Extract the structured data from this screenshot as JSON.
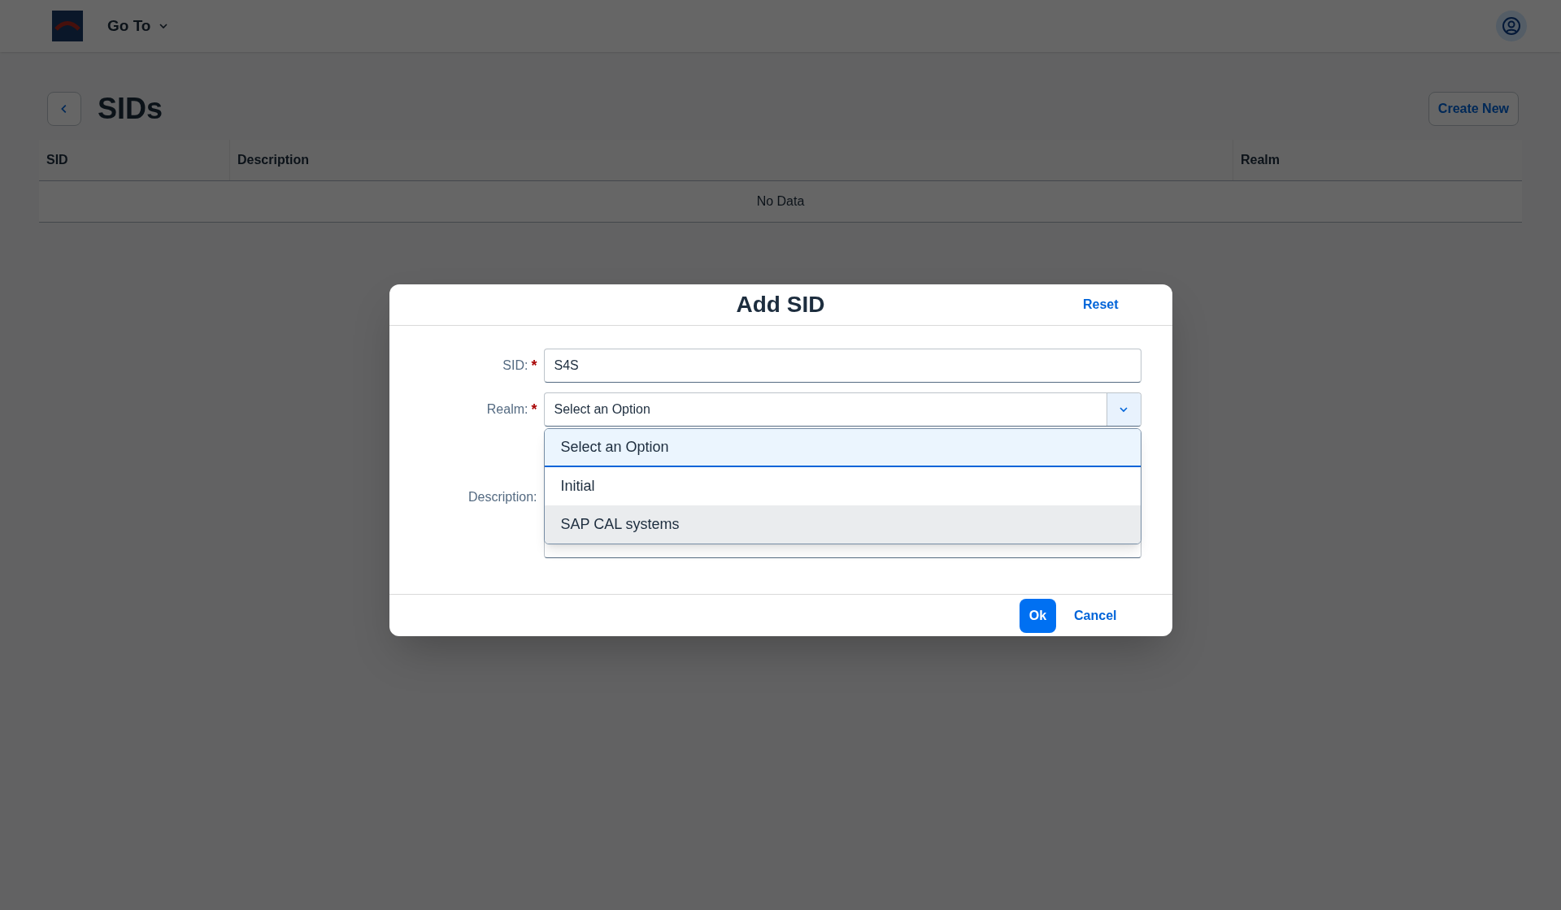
{
  "shell_bar": {
    "menu_label": "Go To"
  },
  "page": {
    "title": "SIDs",
    "create_button": "Create New"
  },
  "table": {
    "columns": [
      "SID",
      "Description",
      "Realm"
    ],
    "empty_text": "No Data"
  },
  "dialog": {
    "title": "Add SID",
    "reset_button": "Reset",
    "fields": [
      {
        "kind": "input",
        "label": "SID:",
        "marker": "*",
        "value": "S4S"
      },
      {
        "kind": "select",
        "label": "Realm:",
        "marker": "*",
        "value": "Select an Option",
        "expanded": true,
        "options": [
          {
            "label": "Select an Option",
            "selected": true,
            "hovered": false
          },
          {
            "label": "Initial",
            "selected": false,
            "hovered": false
          },
          {
            "label": "SAP CAL systems",
            "selected": false,
            "hovered": true
          }
        ]
      },
      {
        "kind": "textarea",
        "label": "Description:"
      }
    ],
    "buttons": [
      {
        "kind": "primary",
        "label": "Ok"
      },
      {
        "kind": "transparent",
        "label": "Cancel"
      }
    ]
  }
}
